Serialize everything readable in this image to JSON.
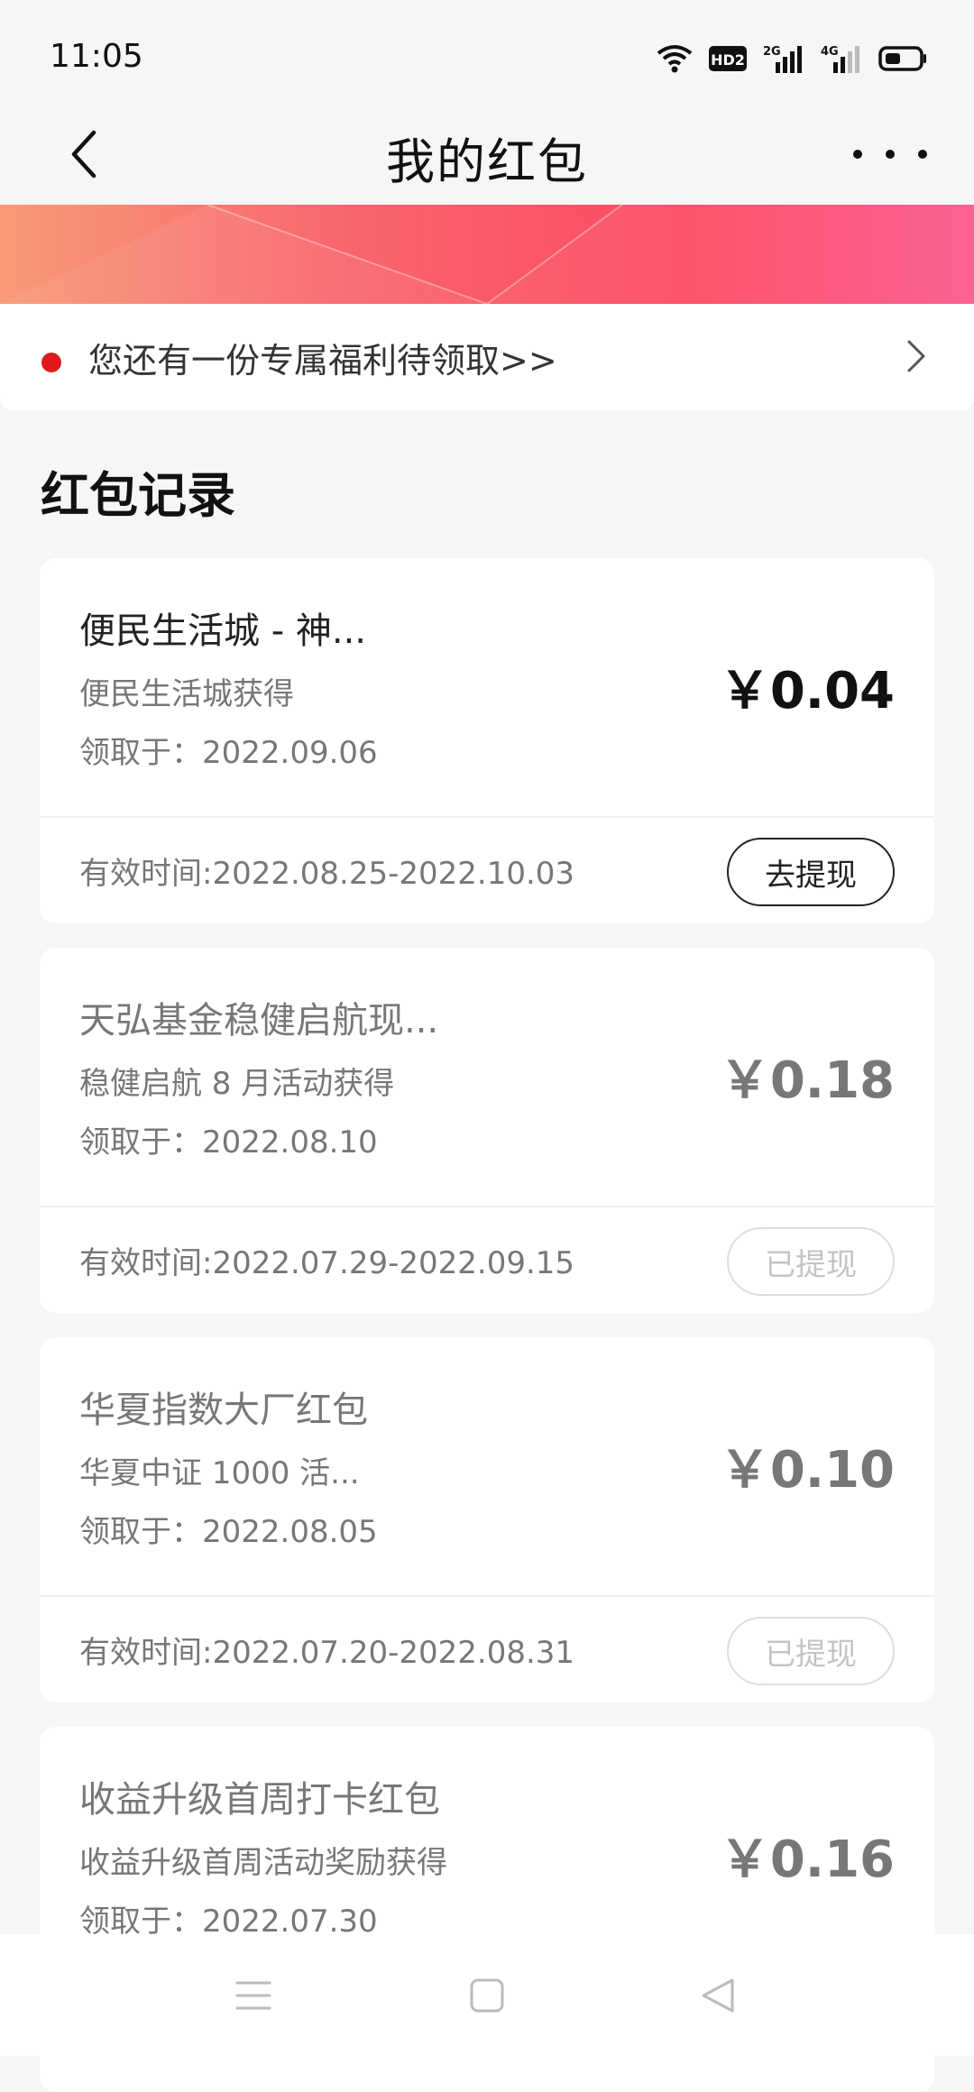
{
  "status": {
    "time": "11:05",
    "hd_label": "HD2",
    "sig1_label": "2G",
    "sig2_label": "4G"
  },
  "nav": {
    "title": "我的红包",
    "more_label": "···"
  },
  "notice": {
    "text": "您还有一份专属福利待领取>>"
  },
  "section": {
    "title": "红包记录"
  },
  "records": [
    {
      "name": "便民生活城 - 神...",
      "source": "便民生活城获得",
      "date": "领取于：2022.09.06",
      "amount": "￥0.04",
      "validity": "有效时间:2022.08.25-2022.10.03",
      "action": "去提现",
      "active": true
    },
    {
      "name": "天弘基金稳健启航现...",
      "source": "稳健启航 8 月活动获得",
      "date": "领取于：2022.08.10",
      "amount": "￥0.18",
      "validity": "有效时间:2022.07.29-2022.09.15",
      "action": "已提现",
      "active": false
    },
    {
      "name": "华夏指数大厂红包",
      "source": "华夏中证 1000 活...",
      "date": "领取于：2022.08.05",
      "amount": "￥0.10",
      "validity": "有效时间:2022.07.20-2022.08.31",
      "action": "已提现",
      "active": false
    },
    {
      "name": "收益升级首周打卡红包",
      "source": "收益升级首周活动奖励获得",
      "date": "领取于：2022.07.30",
      "amount": "￥0.16",
      "active": false
    }
  ],
  "colors": {
    "accent_red": "#e0191e",
    "banner_start": "#f89a78",
    "banner_end": "#fd5a8e"
  }
}
